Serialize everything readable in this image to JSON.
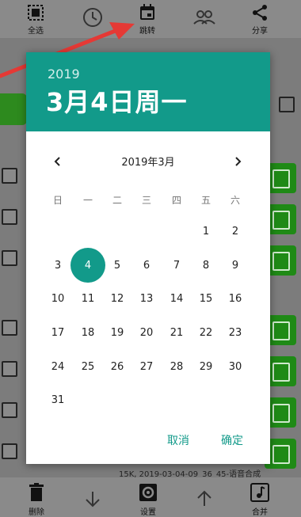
{
  "toolbar": {
    "select_all": "全选",
    "jump": "跳转",
    "share": "分享"
  },
  "background": {
    "info_text": "15K, 2019-03-04-09_36_45-语音合成"
  },
  "bottombar": {
    "delete": "删除",
    "settings": "设置",
    "merge": "合并"
  },
  "dialog": {
    "year": "2019",
    "selected_date": "3月4日周一",
    "month_title": "2019年3月",
    "weekdays": [
      "日",
      "一",
      "二",
      "三",
      "四",
      "五",
      "六"
    ],
    "selected_day": "4",
    "days": [
      [
        "",
        "",
        "",
        "",
        "",
        "1",
        "2"
      ],
      [
        "3",
        "4",
        "5",
        "6",
        "7",
        "8",
        "9"
      ],
      [
        "10",
        "11",
        "12",
        "13",
        "14",
        "15",
        "16"
      ],
      [
        "17",
        "18",
        "19",
        "20",
        "21",
        "22",
        "23"
      ],
      [
        "24",
        "25",
        "26",
        "27",
        "28",
        "29",
        "30"
      ],
      [
        "31",
        "",
        "",
        "",
        "",
        "",
        ""
      ]
    ],
    "cancel_label": "取消",
    "ok_label": "确定",
    "accent_color": "#129a8a"
  },
  "annotation": {
    "arrow_color": "#e53935"
  }
}
